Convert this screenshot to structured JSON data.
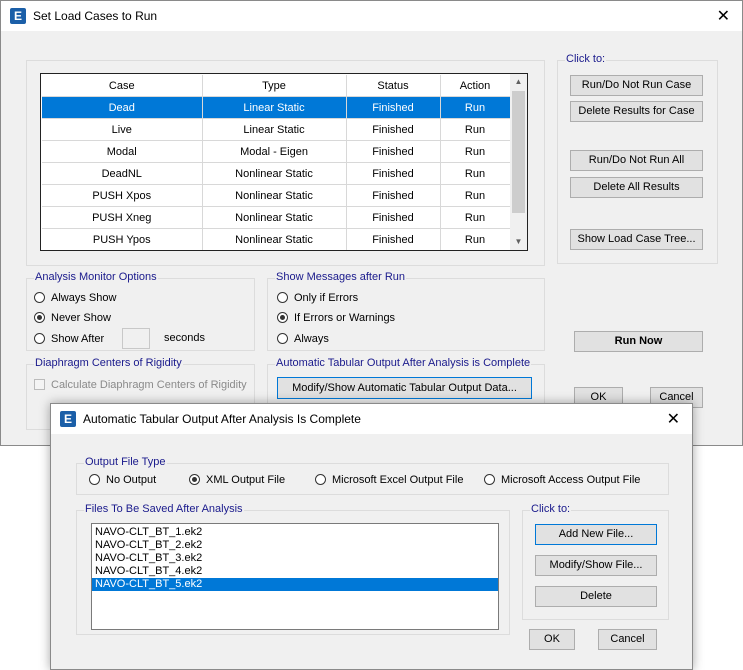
{
  "main_dialog": {
    "title": "Set Load Cases to Run",
    "app_icon_letter": "E",
    "close_glyph": "✕",
    "table": {
      "columns": [
        "Case",
        "Type",
        "Status",
        "Action"
      ],
      "rows": [
        {
          "case": "Dead",
          "type": "Linear Static",
          "status": "Finished",
          "action": "Run"
        },
        {
          "case": "Live",
          "type": "Linear Static",
          "status": "Finished",
          "action": "Run"
        },
        {
          "case": "Modal",
          "type": "Modal - Eigen",
          "status": "Finished",
          "action": "Run"
        },
        {
          "case": "DeadNL",
          "type": "Nonlinear Static",
          "status": "Finished",
          "action": "Run"
        },
        {
          "case": "PUSH Xpos",
          "type": "Nonlinear Static",
          "status": "Finished",
          "action": "Run"
        },
        {
          "case": "PUSH Xneg",
          "type": "Nonlinear Static",
          "status": "Finished",
          "action": "Run"
        },
        {
          "case": "PUSH Ypos",
          "type": "Nonlinear Static",
          "status": "Finished",
          "action": "Run"
        }
      ],
      "selected_row": 0,
      "scroll_up": "▲",
      "scroll_down": "▼"
    },
    "click_to": {
      "label": "Click to:",
      "run_do_not_run_case": "Run/Do Not Run Case",
      "delete_results_for_case": "Delete Results for Case",
      "run_do_not_run_all": "Run/Do Not Run All",
      "delete_all_results": "Delete All Results",
      "show_load_case_tree": "Show Load Case Tree..."
    },
    "analysis_monitor": {
      "label": "Analysis Monitor Options",
      "always_show": "Always Show",
      "never_show": "Never Show",
      "show_after": "Show After",
      "seconds": "seconds",
      "selected": "never_show"
    },
    "show_messages": {
      "label": "Show Messages after Run",
      "only_if_errors": "Only if Errors",
      "if_errors_or_warnings": "If Errors or Warnings",
      "always": "Always",
      "selected": "if_errors_or_warnings"
    },
    "diaphragm": {
      "label": "Diaphragm Centers of Rigidity",
      "calculate": "Calculate Diaphragm Centers of Rigidity"
    },
    "auto_tabular": {
      "label": "Automatic Tabular Output After Analysis is Complete",
      "modify_show_button": "Modify/Show Automatic Tabular Output Data..."
    },
    "run_now": "Run Now",
    "ok": "OK",
    "cancel": "Cancel"
  },
  "sub_dialog": {
    "title": "Automatic Tabular Output After Analysis Is Complete",
    "app_icon_letter": "E",
    "close_glyph": "✕",
    "output_file_type": {
      "label": "Output File Type",
      "options": [
        "No Output",
        "XML Output File",
        "Microsoft Excel Output File",
        "Microsoft Access Output File"
      ],
      "selected_index": 1
    },
    "files": {
      "label": "Files To Be Saved After Analysis",
      "items": [
        "NAVO-CLT_BT_1.ek2",
        "NAVO-CLT_BT_2.ek2",
        "NAVO-CLT_BT_3.ek2",
        "NAVO-CLT_BT_4.ek2",
        "NAVO-CLT_BT_5.ek2"
      ],
      "selected_index": 4
    },
    "click_to": {
      "label": "Click to:",
      "add_new_file": "Add New File...",
      "modify_show_file": "Modify/Show File...",
      "delete": "Delete"
    },
    "ok": "OK",
    "cancel": "Cancel"
  }
}
